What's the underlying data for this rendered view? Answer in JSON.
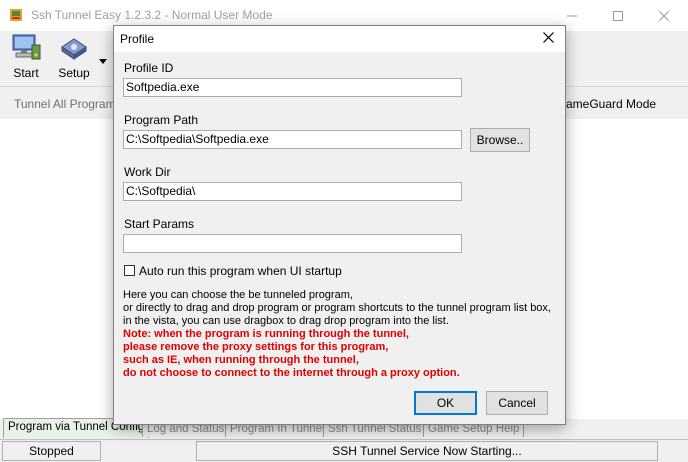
{
  "window": {
    "title": "Ssh Tunnel Easy 1.2.3.2 - Normal User Mode"
  },
  "toolbar": {
    "start_label": "Start",
    "setup_label": "Setup"
  },
  "modebar": {
    "left_label": "Tunnel All Program (F",
    "right_label": "ameGuard Mode"
  },
  "tabs": [
    {
      "label": "Program via Tunnel Config",
      "active": true
    },
    {
      "label": "Log and Status",
      "active": false
    },
    {
      "label": "Program In Tunnel",
      "active": false
    },
    {
      "label": "Ssh Tunnel Status",
      "active": false
    },
    {
      "label": "Game Setup Help",
      "active": false
    }
  ],
  "status": {
    "state": "Stopped",
    "message": "SSH Tunnel Service Now Starting..."
  },
  "dialog": {
    "title": "Profile",
    "profile_id_label": "Profile ID",
    "profile_id_value": "Softpedia.exe",
    "program_path_label": "Program Path",
    "program_path_value": "C:\\Softpedia\\Softpedia.exe",
    "browse_label": "Browse..",
    "work_dir_label": "Work Dir",
    "work_dir_value": "C:\\Softpedia\\",
    "start_params_label": "Start Params",
    "start_params_value": "",
    "autorun_label": "Auto run this program when UI startup",
    "autorun_checked": false,
    "help_lines": [
      "Here you can choose the be tunneled program,",
      "or directly to drag and drop program or program shortcuts to the tunnel program list box,",
      "in the vista, you can use dragbox to drag drop program into the list."
    ],
    "note_lines": [
      "Note: when the program is running through the tunnel,",
      "please remove the proxy settings for this program,",
      "such as IE, when running through the tunnel,",
      "do not choose to connect to the internet through a proxy option."
    ],
    "ok_label": "OK",
    "cancel_label": "Cancel"
  },
  "colors": {
    "note": "#e00000",
    "default_button_border": "#0078d7",
    "active_tab": "#e9f2e9"
  }
}
